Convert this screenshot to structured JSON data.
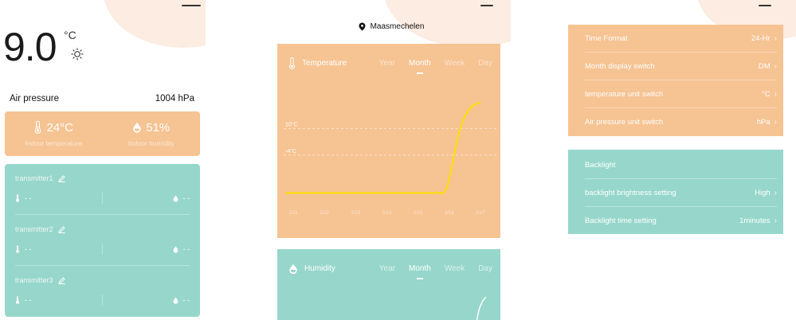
{
  "colors": {
    "orange": "#f6c393",
    "teal": "#97d7cb",
    "chart_line": "#ffe000"
  },
  "home": {
    "outdoor_temp": "9.0",
    "outdoor_unit": "°C",
    "weather_icon": "sun-icon",
    "air_pressure_label": "Air pressure",
    "air_pressure_value": "1004 hPa",
    "indoor": {
      "temperature_value": "24°C",
      "temperature_label": "Indoor temperature",
      "humidity_value": "51%",
      "humidity_label": "Indoor humidity"
    },
    "transmitters": [
      {
        "name": "transmitter1",
        "temp": "- -",
        "humidity": "- -"
      },
      {
        "name": "transmitter2",
        "temp": "- -",
        "humidity": "- -"
      },
      {
        "name": "transmitter3",
        "temp": "- -",
        "humidity": "- -"
      }
    ]
  },
  "charts": {
    "location": "Maasmechelen",
    "tabs": [
      "Year",
      "Month",
      "Week",
      "Day"
    ],
    "active_tab": "Month",
    "temperature_title": "Temperature",
    "humidity_title": "Humidity"
  },
  "chart_data": [
    {
      "type": "line",
      "title": "Temperature",
      "x": [
        "2/11",
        "2/12",
        "2/13",
        "2/14",
        "2/15",
        "2/16",
        "2/17"
      ],
      "y_ticks": [
        "10°C",
        "-4°C"
      ],
      "values": [
        -24,
        -24,
        -24,
        -24,
        -24,
        -24,
        24
      ],
      "ylim": [
        -31,
        38
      ],
      "grid": true
    },
    {
      "type": "line",
      "title": "Humidity",
      "x": [],
      "values": [],
      "grid": false
    }
  ],
  "settings": {
    "general": [
      {
        "label": "Time Format",
        "value": "24-Hr"
      },
      {
        "label": "Month display switch",
        "value": "DM"
      },
      {
        "label": "temperature unit switch",
        "value": "°C"
      },
      {
        "label": "Air pressure unit switch",
        "value": "hPa"
      }
    ],
    "backlight_header": "Backlight",
    "backlight": [
      {
        "label": "backlight brightness setting",
        "value": "High"
      },
      {
        "label": "Backlight time setting",
        "value": "1minutes"
      }
    ]
  }
}
